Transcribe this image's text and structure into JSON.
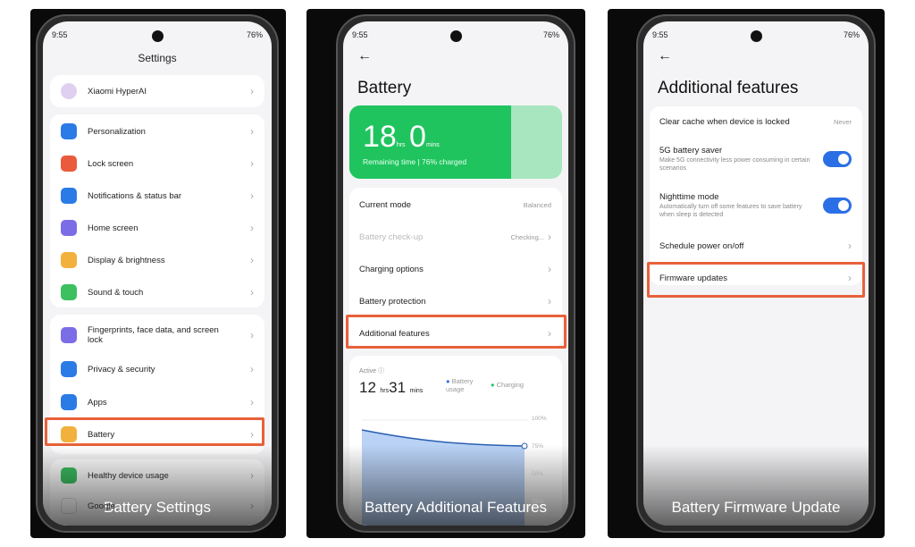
{
  "status": {
    "time": "9:55",
    "battery": "76%"
  },
  "panel1": {
    "title": "Settings",
    "caption": "Battery Settings",
    "items": [
      {
        "label": "Xiaomi HyperAI",
        "color": "#c8a0e0"
      },
      {
        "label": "Personalization",
        "color": "#2b7be6"
      },
      {
        "label": "Lock screen",
        "color": "#ea5a3c"
      },
      {
        "label": "Notifications & status bar",
        "color": "#2b7be6"
      },
      {
        "label": "Home screen",
        "color": "#7b6de6"
      },
      {
        "label": "Display & brightness",
        "color": "#f2b03c"
      },
      {
        "label": "Sound & touch",
        "color": "#3cc060"
      },
      {
        "label": "Fingerprints, face data, and screen lock",
        "color": "#7b6de6"
      },
      {
        "label": "Privacy & security",
        "color": "#2b7be6"
      },
      {
        "label": "Apps",
        "color": "#2b7be6"
      },
      {
        "label": "Battery",
        "color": "#f2b03c"
      },
      {
        "label": "Healthy device usage",
        "color": "#3cc060"
      },
      {
        "label": "Google",
        "color": "#ffffff"
      }
    ]
  },
  "panel2": {
    "title": "Battery",
    "caption": "Battery Additional Features",
    "hero": {
      "hours": "18",
      "hrs_unit": "hrs",
      "mins": "0",
      "mins_unit": "mins",
      "subtitle": "Remaining time | 76% charged",
      "level": 76,
      "color": "#1fc45e"
    },
    "items": [
      {
        "label": "Current mode",
        "value": "Balanced"
      },
      {
        "label": "Battery check-up",
        "value": "Checking..."
      },
      {
        "label": "Charging options",
        "value": ""
      },
      {
        "label": "Battery protection",
        "value": ""
      },
      {
        "label": "Additional features",
        "value": ""
      }
    ],
    "usage": {
      "active_label": "Active",
      "hours": "12",
      "hrs_unit": "hrs",
      "mins": "31",
      "mins_unit": "mins",
      "legend_usage": "Battery usage",
      "legend_charging": "Charging",
      "ticks": [
        "100%",
        "75%",
        "50%",
        "25%"
      ]
    }
  },
  "panel3": {
    "title": "Additional features",
    "caption": "Battery Firmware Update",
    "items": [
      {
        "label": "Clear cache when device is locked",
        "value": "Never"
      },
      {
        "label": "5G battery saver",
        "desc": "Make 5G connectivity less power consuming in certain scenarios",
        "on": true
      },
      {
        "label": "Nighttime mode",
        "desc": "Automatically turn off some features to save battery when sleep is detected",
        "on": true
      },
      {
        "label": "Schedule power on/off"
      },
      {
        "label": "Firmware updates"
      }
    ]
  }
}
